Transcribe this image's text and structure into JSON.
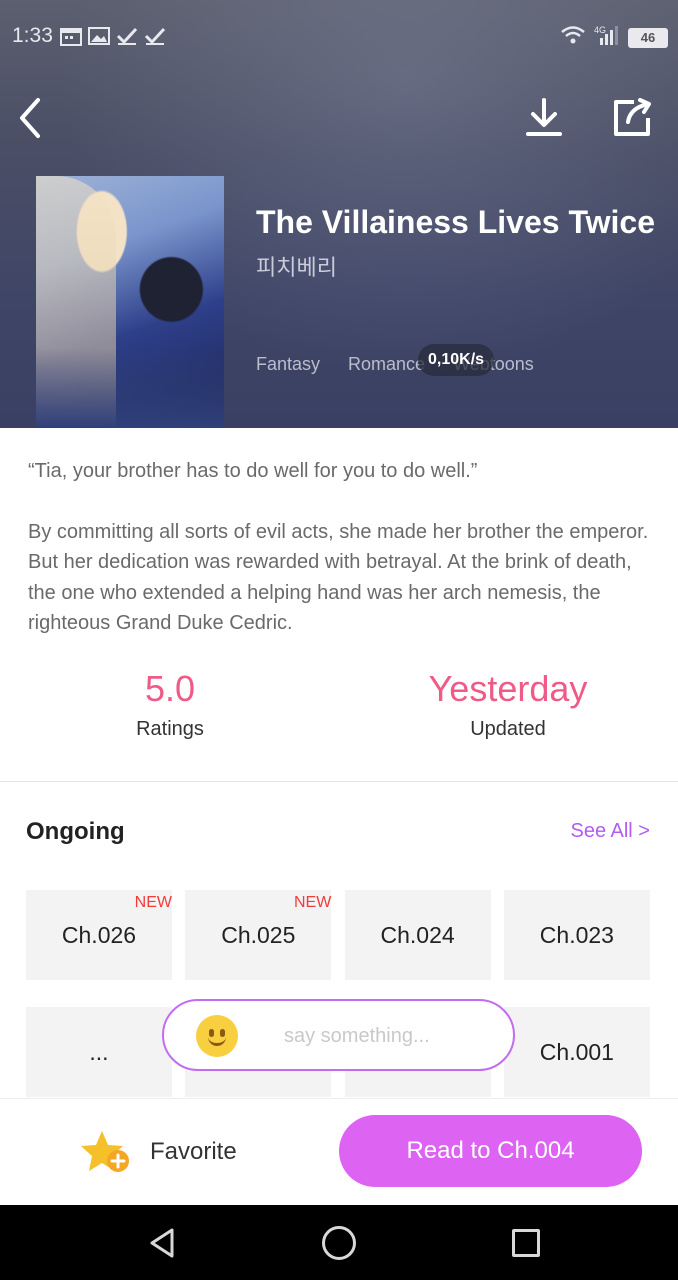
{
  "status_bar": {
    "time": "1:33",
    "battery": "46",
    "network": "4G"
  },
  "header": {
    "title": "The Villainess Lives Twice",
    "author": "피치베리",
    "tags": [
      "Fantasy",
      "Romance",
      "Webtoons"
    ],
    "speed": "0,10K/s"
  },
  "description": {
    "quote": "“Tia, your brother has to do well for you to do well.”",
    "body": "By committing all sorts of evil acts, she made her brother the emperor. But her dedication was rewarded with betrayal. At the brink of death, the one who extended a helping hand was her arch nemesis, the righteous Grand Duke Cedric."
  },
  "stats": {
    "rating_value": "5.0",
    "rating_label": "Ratings",
    "updated_value": "Yesterday",
    "updated_label": "Updated"
  },
  "chapters": {
    "section_title": "Ongoing",
    "see_all": "See All >",
    "new_badge": "NEW",
    "row1": [
      "Ch.026",
      "Ch.025",
      "Ch.024",
      "Ch.023"
    ],
    "row2_first": "...",
    "row2_last": "Ch.001"
  },
  "comment": {
    "placeholder": "say something..."
  },
  "bottom": {
    "favorite_label": "Favorite",
    "read_button": "Read to Ch.004"
  },
  "colors": {
    "accent_pink": "#ef5a87",
    "accent_purple": "#dd63f2",
    "see_all": "#b25cf0",
    "new_badge": "#f23b3b"
  }
}
